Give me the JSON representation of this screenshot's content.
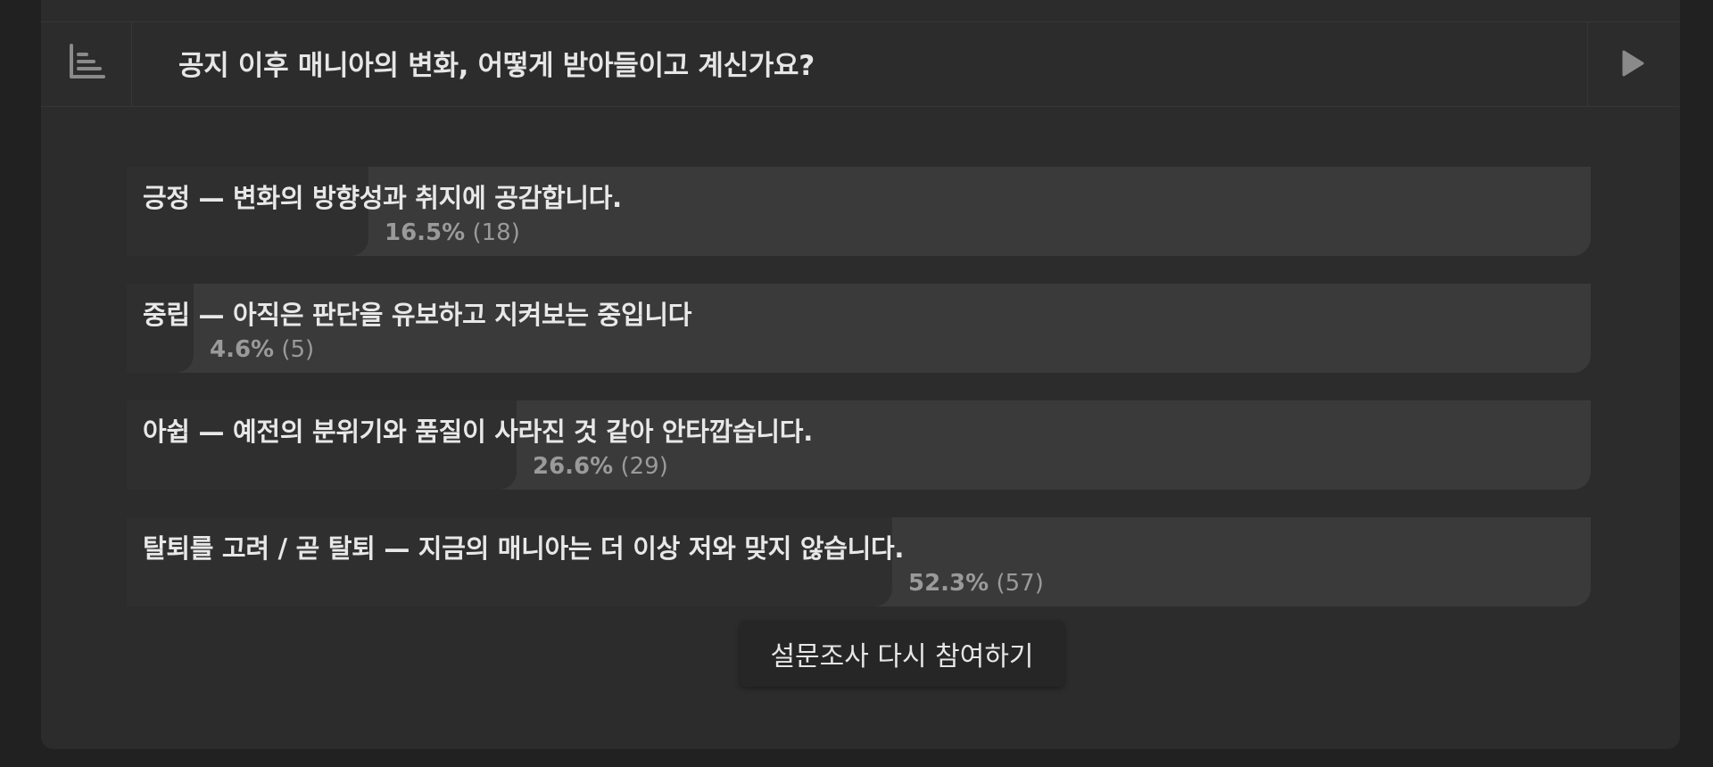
{
  "poll": {
    "title": "공지 이후 매니아의 변화, 어떻게 받아들이고 계신가요?",
    "icons": {
      "results": "bar-chart-icon",
      "submit": "play-icon"
    },
    "options": [
      {
        "label": "긍정 — 변화의 방향성과 취지에 공감합니다.",
        "percent": "16.5%",
        "count": "(18)",
        "fraction": 0.165
      },
      {
        "label": "중립 — 아직은 판단을 유보하고 지켜보는 중입니다",
        "percent": "4.6%",
        "count": "(5)",
        "fraction": 0.046
      },
      {
        "label": "아쉽 — 예전의 분위기와 품질이 사라진 것 같아 안타깝습니다.",
        "percent": "26.6%",
        "count": "(29)",
        "fraction": 0.266
      },
      {
        "label": "탈퇴를 고려 / 곧 탈퇴 — 지금의 매니아는 더 이상 저와 맞지 않습니다.",
        "percent": "52.3%",
        "count": "(57)",
        "fraction": 0.523
      }
    ],
    "retake_label": "설문조사 다시 참여하기"
  },
  "colors": {
    "page_bg": "#212121",
    "panel_bg": "#2c2c2c",
    "bar_track": "#3a3a3a",
    "bar_fill": "#2f2f2f",
    "text": "#e8e8e8",
    "muted": "#9a9a9a"
  }
}
